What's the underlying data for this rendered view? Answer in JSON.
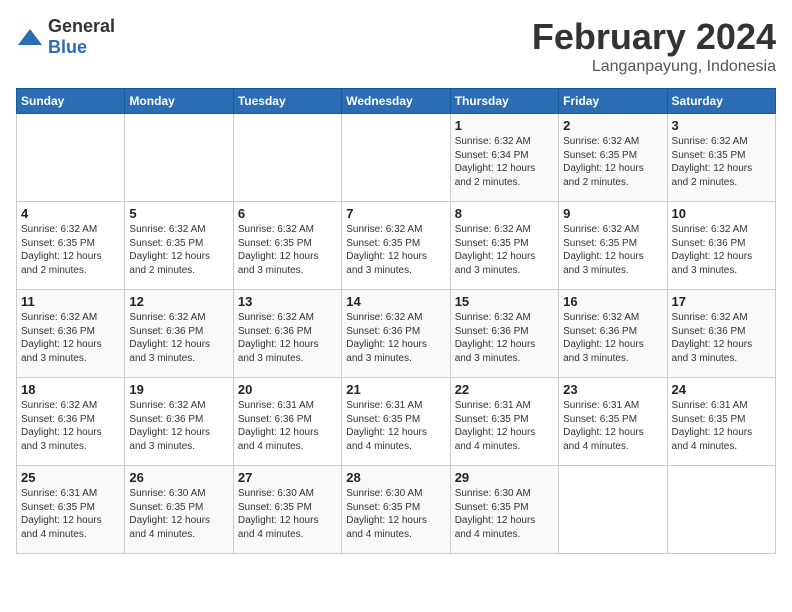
{
  "header": {
    "logo_general": "General",
    "logo_blue": "Blue",
    "title": "February 2024",
    "subtitle": "Langanpayung, Indonesia"
  },
  "days_of_week": [
    "Sunday",
    "Monday",
    "Tuesday",
    "Wednesday",
    "Thursday",
    "Friday",
    "Saturday"
  ],
  "weeks": [
    [
      {
        "day": "",
        "detail": ""
      },
      {
        "day": "",
        "detail": ""
      },
      {
        "day": "",
        "detail": ""
      },
      {
        "day": "",
        "detail": ""
      },
      {
        "day": "1",
        "detail": "Sunrise: 6:32 AM\nSunset: 6:34 PM\nDaylight: 12 hours\nand 2 minutes."
      },
      {
        "day": "2",
        "detail": "Sunrise: 6:32 AM\nSunset: 6:35 PM\nDaylight: 12 hours\nand 2 minutes."
      },
      {
        "day": "3",
        "detail": "Sunrise: 6:32 AM\nSunset: 6:35 PM\nDaylight: 12 hours\nand 2 minutes."
      }
    ],
    [
      {
        "day": "4",
        "detail": "Sunrise: 6:32 AM\nSunset: 6:35 PM\nDaylight: 12 hours\nand 2 minutes."
      },
      {
        "day": "5",
        "detail": "Sunrise: 6:32 AM\nSunset: 6:35 PM\nDaylight: 12 hours\nand 2 minutes."
      },
      {
        "day": "6",
        "detail": "Sunrise: 6:32 AM\nSunset: 6:35 PM\nDaylight: 12 hours\nand 3 minutes."
      },
      {
        "day": "7",
        "detail": "Sunrise: 6:32 AM\nSunset: 6:35 PM\nDaylight: 12 hours\nand 3 minutes."
      },
      {
        "day": "8",
        "detail": "Sunrise: 6:32 AM\nSunset: 6:35 PM\nDaylight: 12 hours\nand 3 minutes."
      },
      {
        "day": "9",
        "detail": "Sunrise: 6:32 AM\nSunset: 6:35 PM\nDaylight: 12 hours\nand 3 minutes."
      },
      {
        "day": "10",
        "detail": "Sunrise: 6:32 AM\nSunset: 6:36 PM\nDaylight: 12 hours\nand 3 minutes."
      }
    ],
    [
      {
        "day": "11",
        "detail": "Sunrise: 6:32 AM\nSunset: 6:36 PM\nDaylight: 12 hours\nand 3 minutes."
      },
      {
        "day": "12",
        "detail": "Sunrise: 6:32 AM\nSunset: 6:36 PM\nDaylight: 12 hours\nand 3 minutes."
      },
      {
        "day": "13",
        "detail": "Sunrise: 6:32 AM\nSunset: 6:36 PM\nDaylight: 12 hours\nand 3 minutes."
      },
      {
        "day": "14",
        "detail": "Sunrise: 6:32 AM\nSunset: 6:36 PM\nDaylight: 12 hours\nand 3 minutes."
      },
      {
        "day": "15",
        "detail": "Sunrise: 6:32 AM\nSunset: 6:36 PM\nDaylight: 12 hours\nand 3 minutes."
      },
      {
        "day": "16",
        "detail": "Sunrise: 6:32 AM\nSunset: 6:36 PM\nDaylight: 12 hours\nand 3 minutes."
      },
      {
        "day": "17",
        "detail": "Sunrise: 6:32 AM\nSunset: 6:36 PM\nDaylight: 12 hours\nand 3 minutes."
      }
    ],
    [
      {
        "day": "18",
        "detail": "Sunrise: 6:32 AM\nSunset: 6:36 PM\nDaylight: 12 hours\nand 3 minutes."
      },
      {
        "day": "19",
        "detail": "Sunrise: 6:32 AM\nSunset: 6:36 PM\nDaylight: 12 hours\nand 3 minutes."
      },
      {
        "day": "20",
        "detail": "Sunrise: 6:31 AM\nSunset: 6:36 PM\nDaylight: 12 hours\nand 4 minutes."
      },
      {
        "day": "21",
        "detail": "Sunrise: 6:31 AM\nSunset: 6:35 PM\nDaylight: 12 hours\nand 4 minutes."
      },
      {
        "day": "22",
        "detail": "Sunrise: 6:31 AM\nSunset: 6:35 PM\nDaylight: 12 hours\nand 4 minutes."
      },
      {
        "day": "23",
        "detail": "Sunrise: 6:31 AM\nSunset: 6:35 PM\nDaylight: 12 hours\nand 4 minutes."
      },
      {
        "day": "24",
        "detail": "Sunrise: 6:31 AM\nSunset: 6:35 PM\nDaylight: 12 hours\nand 4 minutes."
      }
    ],
    [
      {
        "day": "25",
        "detail": "Sunrise: 6:31 AM\nSunset: 6:35 PM\nDaylight: 12 hours\nand 4 minutes."
      },
      {
        "day": "26",
        "detail": "Sunrise: 6:30 AM\nSunset: 6:35 PM\nDaylight: 12 hours\nand 4 minutes."
      },
      {
        "day": "27",
        "detail": "Sunrise: 6:30 AM\nSunset: 6:35 PM\nDaylight: 12 hours\nand 4 minutes."
      },
      {
        "day": "28",
        "detail": "Sunrise: 6:30 AM\nSunset: 6:35 PM\nDaylight: 12 hours\nand 4 minutes."
      },
      {
        "day": "29",
        "detail": "Sunrise: 6:30 AM\nSunset: 6:35 PM\nDaylight: 12 hours\nand 4 minutes."
      },
      {
        "day": "",
        "detail": ""
      },
      {
        "day": "",
        "detail": ""
      }
    ]
  ]
}
